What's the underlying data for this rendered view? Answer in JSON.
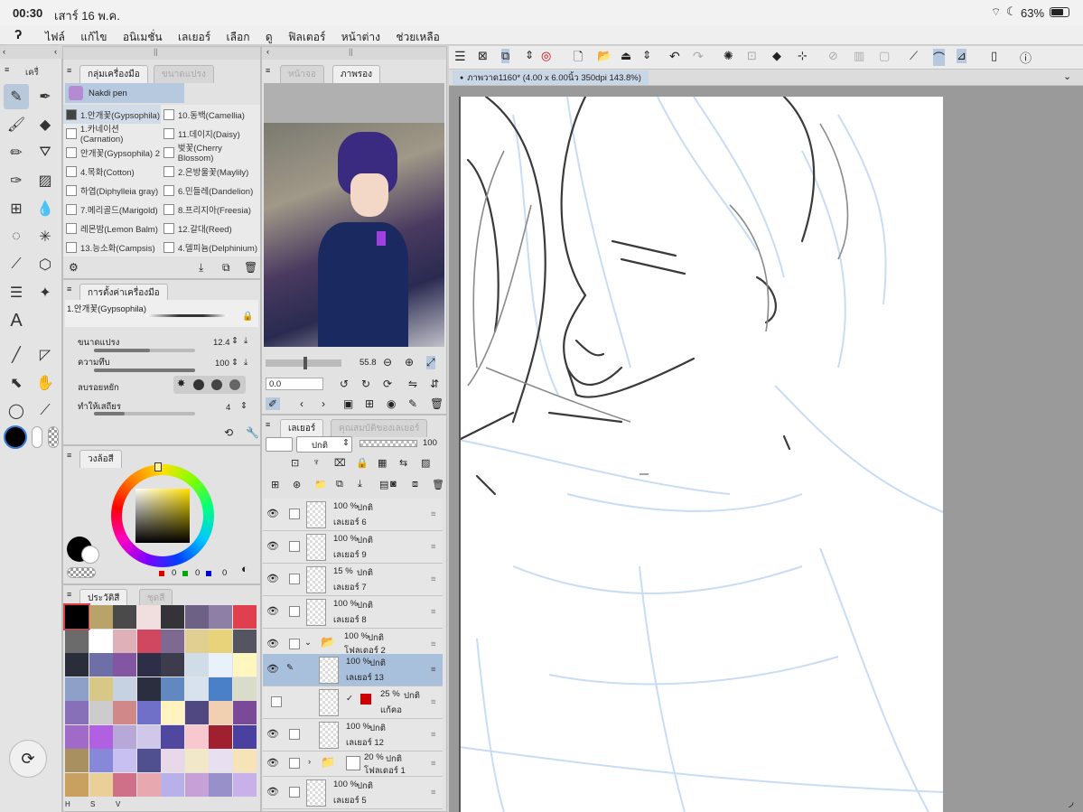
{
  "status": {
    "time": "00:30",
    "date": "เสาร์ 16 พ.ค.",
    "battery": "63%"
  },
  "menu": [
    "ไฟล์",
    "แก้ไข",
    "อนิเมชั่น",
    "เลเยอร์",
    "เลือก",
    "ดู",
    "ฟิลเตอร์",
    "หน้าต่าง",
    "ช่วยเหลือ"
  ],
  "tool_panel": {
    "tab_tool": "เครื่",
    "tab_subtool_group": "กลุ่มเครื่องมือ",
    "tab_brush_size": "ขนาดแปรง",
    "group_name": "Nakdi pen",
    "brushes_left": [
      "1.안개꽃(Gypsophila)",
      "1.카네이션(Carnation)",
      "안개꽃(Gypsophila) 2",
      "4.목화(Cotton)",
      "하엽(Diphylleia gray)",
      "7.메리골드(Marigold)",
      "레몬밤(Lemon Balm)",
      "13.능소화(Campsis)"
    ],
    "brushes_right": [
      "10.동백(Camellia)",
      "11.데이지(Daisy)",
      "벚꽃(Cherry Blossom)",
      "2.은방울꽃(Maylily)",
      "6.민들레(Dandelion)",
      "8.프리지아(Freesia)",
      "12.갈대(Reed)",
      "4.델피늄(Delphinium)"
    ]
  },
  "tool_settings": {
    "tab": "การตั้งค่าเครื่องมือ",
    "brush_name": "1.안개꽃(Gypsophila)",
    "size_label": "ขนาดแปรง",
    "size_value": "12.4",
    "size_pct": 0.55,
    "opacity_label": "ความทึบ",
    "opacity_value": "100",
    "opacity_pct": 1.0,
    "antialias_label": "ลบรอยหยัก",
    "stabilizer_label": "ทำให้เสถียร",
    "stabilizer_value": "4",
    "stabilizer_pct": 0.3
  },
  "color_wheel": {
    "tab": "วงล้อสี",
    "r": "0",
    "g": "0",
    "b": "0",
    "main_color": "#000000"
  },
  "palette": {
    "tab_history": "ประวัติสี",
    "tab_set": "ชุดสี",
    "colors": [
      "#000000",
      "#b8a46a",
      "#4a4a4a",
      "#f1dfe0",
      "#333338",
      "#6e6186",
      "#8e7fa6",
      "#e0404e",
      "#6b6b6b",
      "#ffffff",
      "#e0b0b8",
      "#d04860",
      "#7e6a90",
      "#e0cf90",
      "#e8d27a",
      "#555562",
      "#2a2e3a",
      "#6f6fa8",
      "#8256a2",
      "#2e2e48",
      "#3c3c4c",
      "#d0dce8",
      "#e9f2fb",
      "#fff6c0",
      "#8fa0c8",
      "#d8c888",
      "#c6d2e2",
      "#2a2e3e",
      "#6288c0",
      "#d8e2ee",
      "#4a80c8",
      "#d8dcc8",
      "#8870b8",
      "#cccccc",
      "#d08888",
      "#7070c8",
      "#fff4c0",
      "#504880",
      "#f0d0b0",
      "#7a4a98",
      "#a06ac8",
      "#b060e0",
      "#b8a8d8",
      "#cfc8e8",
      "#5048a0",
      "#f8c8d0",
      "#a02030",
      "#4a40a0",
      "#a89060",
      "#8888d8",
      "#c8c0f0",
      "#505090",
      "#e8d8e8",
      "#f0e8c8",
      "#e8e0f0",
      "#f6e4b8",
      "#c8a060",
      "#e8d098",
      "#d07088",
      "#e8a8b0",
      "#b8b0e8",
      "#c8a0d8",
      "#9890c8",
      "#c8b0e8"
    ]
  },
  "navigator": {
    "tab_1": "หน้าจอ",
    "tab_2": "ภาพรอง",
    "zoom": "55.8",
    "rotate": "0.0"
  },
  "layers": {
    "tab": "เลเยอร์",
    "tab2": "คุณสมบัติของเลเยอร์",
    "blend": "ปกติ",
    "opacity": "100",
    "items": [
      {
        "opacity": "100 %",
        "mode": "ปกติ",
        "name": "เลเยอร์ 6"
      },
      {
        "opacity": "100 %",
        "mode": "ปกติ",
        "name": "เลเยอร์ 9"
      },
      {
        "opacity": "15 %",
        "mode": "ปกติ",
        "name": "เลเยอร์ 7"
      },
      {
        "opacity": "100 %",
        "mode": "ปกติ",
        "name": "เลเยอร์ 8"
      },
      {
        "opacity": "100 %",
        "mode": "ปกติ",
        "name": "โฟลเดอร์ 2"
      },
      {
        "opacity": "100 %",
        "mode": "ปกติ",
        "name": "เลเยอร์ 13"
      },
      {
        "opacity": "25 %",
        "mode": "ปกติ",
        "name": "แก้คอ"
      },
      {
        "opacity": "100 %",
        "mode": "ปกติ",
        "name": "เลเยอร์ 12"
      },
      {
        "opacity": "20 %",
        "mode": "ปกติ",
        "name": "โฟลเดอร์ 1"
      },
      {
        "opacity": "100 %",
        "mode": "ปกติ",
        "name": "เลเยอร์ 5"
      }
    ]
  },
  "canvas": {
    "tab_title": "ภาพวาด1160* (4.00 x 6.00นิ้ว 350dpi 143.8%)"
  },
  "hsv": [
    "H",
    "S",
    "V"
  ]
}
